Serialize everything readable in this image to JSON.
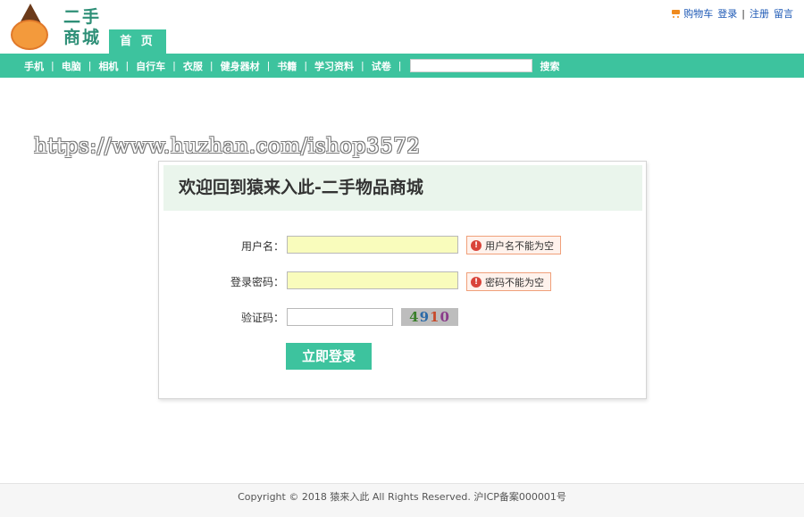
{
  "header": {
    "logo_text": "二手商城",
    "home_tab": "首 页",
    "cart_label": "购物车",
    "login_label": "登录",
    "register_label": "注册",
    "message_label": "留言"
  },
  "nav": {
    "items": [
      "手机",
      "电脑",
      "相机",
      "自行车",
      "衣服",
      "健身器材",
      "书籍",
      "学习资料",
      "试卷"
    ],
    "search_value": "",
    "search_button": "搜索"
  },
  "watermark": "https://www.huzhan.com/ishop3572",
  "login": {
    "title": "欢迎回到猿来入此-二手物品商城",
    "username_label": "用户名：",
    "username_value": "",
    "username_error": "用户名不能为空",
    "password_label": "登录密码：",
    "password_value": "",
    "password_error": "密码不能为空",
    "captcha_label": "验证码：",
    "captcha_value": "",
    "captcha_code": [
      "4",
      "9",
      "1",
      "0"
    ],
    "submit_label": "立即登录"
  },
  "footer": {
    "text": "Copyright © 2018 猿来入此 All Rights Reserved. 沪ICP备案000001号"
  },
  "colors": {
    "accent": "#3dc39e",
    "error_border": "#f0a07a",
    "invalid_field": "#f9fcbc",
    "link": "#1c58b5"
  }
}
